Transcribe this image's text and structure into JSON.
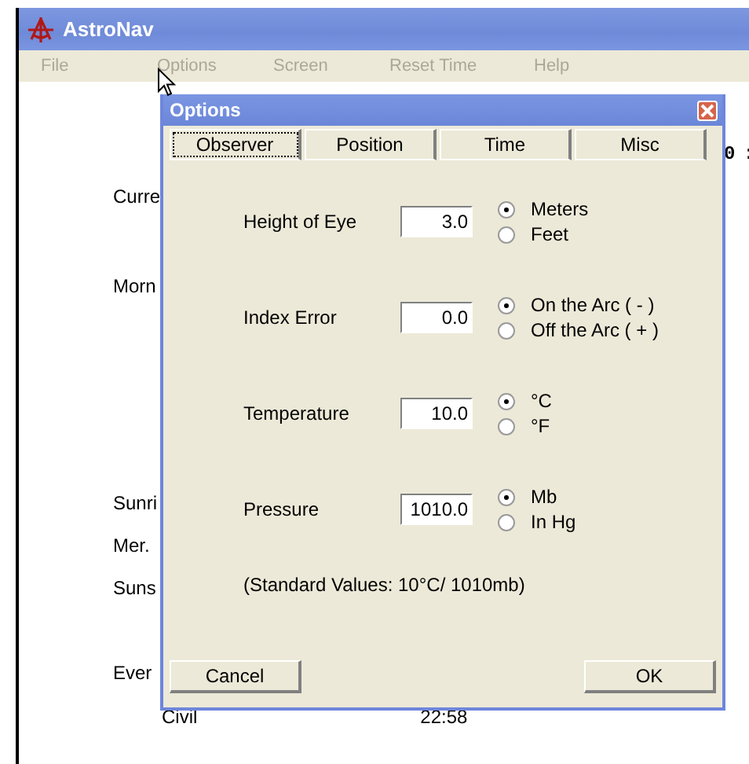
{
  "window": {
    "title": "AstroNav"
  },
  "menu": [
    {
      "label": "File",
      "disabled": true
    },
    {
      "label": "Options",
      "disabled": true
    },
    {
      "label": "Screen",
      "disabled": true
    },
    {
      "label": "Reset Time",
      "disabled": true
    },
    {
      "label": "Help",
      "disabled": true
    }
  ],
  "clock_fragment": "0 :",
  "background_rows": [
    {
      "label": "Curre"
    },
    {
      "label": "Morn"
    },
    {
      "label": "Sunri"
    },
    {
      "label": "Mer."
    },
    {
      "label": "Suns"
    },
    {
      "label": "Ever",
      "children": [
        {
          "label": "Civil",
          "value": "22:58"
        }
      ]
    }
  ],
  "dialog": {
    "title": "Options",
    "tabs": [
      {
        "label": "Observer",
        "selected": true
      },
      {
        "label": "Position",
        "selected": false
      },
      {
        "label": "Time",
        "selected": false
      },
      {
        "label": "Misc",
        "selected": false
      }
    ],
    "settings": [
      {
        "label": "Height of Eye",
        "value": "3.0",
        "options": [
          {
            "label": "Meters",
            "selected": true
          },
          {
            "label": "Feet",
            "selected": false
          }
        ]
      },
      {
        "label": "Index Error",
        "value": "0.0",
        "options": [
          {
            "label": "On the Arc ( - )",
            "selected": true
          },
          {
            "label": "Off the Arc ( + )",
            "selected": false
          }
        ]
      },
      {
        "label": "Temperature",
        "value": "10.0",
        "options": [
          {
            "label": "°C",
            "selected": true
          },
          {
            "label": "°F",
            "selected": false
          }
        ]
      },
      {
        "label": "Pressure",
        "value": "1010.0",
        "options": [
          {
            "label": "Mb",
            "selected": true
          },
          {
            "label": "In Hg",
            "selected": false
          }
        ]
      }
    ],
    "note": "(Standard Values: 10°C/ 1010mb)",
    "buttons": [
      "Cancel",
      "OK"
    ]
  }
}
